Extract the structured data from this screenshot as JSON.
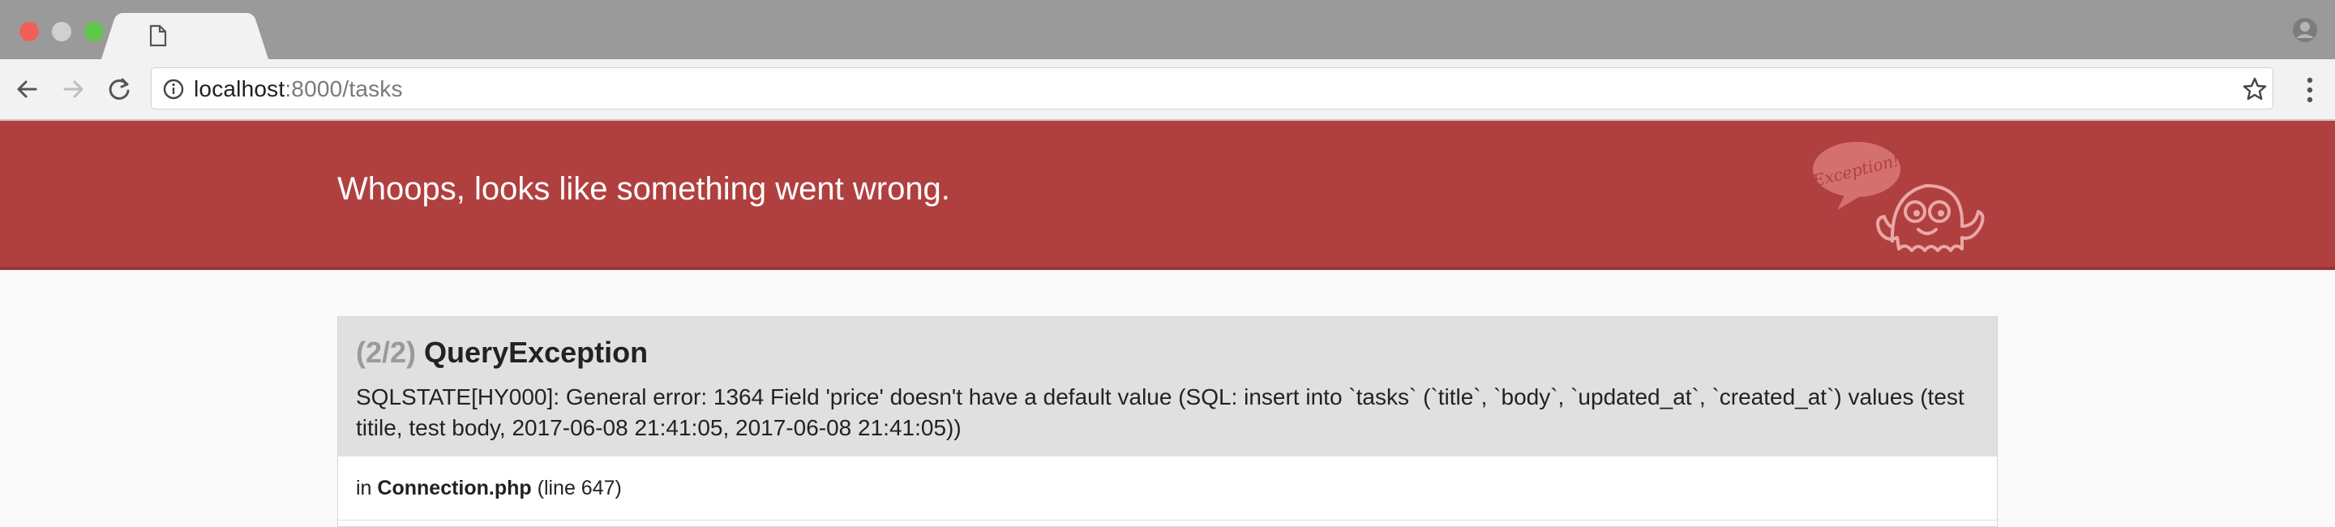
{
  "browser": {
    "url_host": "localhost",
    "url_path": ":8000/tasks",
    "colors": {
      "titlebar": "#9a9a9a",
      "close": "#f25f58",
      "maximize": "#5fc74a"
    }
  },
  "page": {
    "banner_title": "Whoops, looks like something went wrong.",
    "ghost_bubble_text": "Exception!",
    "banner_color": "#b0403f",
    "exception": {
      "count": "(2/2)",
      "name": "QueryException",
      "message": "SQLSTATE[HY000]: General error: 1364 Field 'price' doesn't have a default value (SQL: insert into `tasks` (`title`, `body`, `updated_at`, `created_at`) values (test titile, test body, 2017-06-08 21:41:05, 2017-06-08 21:41:05))"
    },
    "frame": {
      "prefix": "in",
      "file": "Connection.php",
      "line": "(line 647)"
    }
  },
  "icons": [
    "page-icon",
    "profile-icon",
    "back-arrow-icon",
    "forward-arrow-icon",
    "reload-icon",
    "info-icon",
    "star-icon",
    "menu-dots-icon",
    "ghost-mascot-icon"
  ]
}
